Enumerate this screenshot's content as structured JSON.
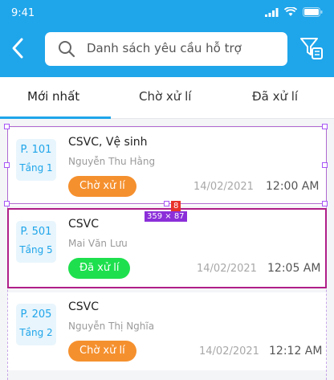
{
  "status_bar": {
    "time": "9:41"
  },
  "header": {
    "search_placeholder": "Danh sách yêu cầu hỗ trợ"
  },
  "tabs": [
    {
      "label": "Mới nhất"
    },
    {
      "label": "Chờ xử lí"
    },
    {
      "label": "Đã xử lí"
    }
  ],
  "requests": [
    {
      "room": "P. 101",
      "floor": "Tầng 1",
      "title": "CSVC, Vệ sinh",
      "person": "Nguyễn Thu Hằng",
      "status": "Chờ xử lí",
      "status_color": "#f5902e",
      "date": "14/02/2021",
      "time": "12:00 AM"
    },
    {
      "room": "P. 501",
      "floor": "Tầng 5",
      "title": "CSVC",
      "person": "Mai Văn Lưu",
      "status": "Đã xử lí",
      "status_color": "#1ee04e",
      "date": "14/02/2021",
      "time": "12:05 AM"
    },
    {
      "room": "P. 205",
      "floor": "Tầng 2",
      "title": "CSVC",
      "person": "Nguyễn Thị Nghĩa",
      "status": "Chờ xử lí",
      "status_color": "#f5902e",
      "date": "14/02/2021",
      "time": "12:12 AM"
    }
  ],
  "overlay": {
    "index_tag": "8",
    "size_tag": "359 × 87"
  },
  "colors": {
    "primary": "#1fa5ea",
    "selection": "#b01e88"
  }
}
